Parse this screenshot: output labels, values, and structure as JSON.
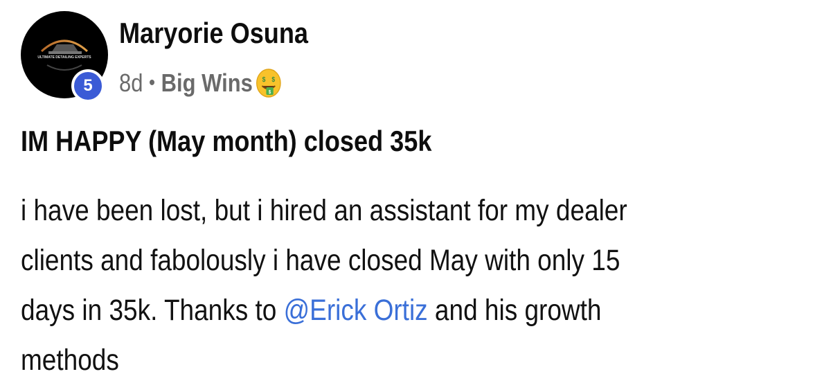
{
  "post": {
    "author_name": "Maryorie Osuna",
    "level": "5",
    "time_ago": "8d",
    "separator": "•",
    "category": "Big Wins",
    "category_emoji": "money-mouth-face-icon",
    "avatar_logo_text": "ULTIMATE DETAILING EXPERTS",
    "title": "IM HAPPY (May month) closed 35k",
    "body": {
      "line1": "i have been lost, but i hired an assistant for my dealer",
      "line2": "clients and fabolously i have closed May with only 15",
      "line3_before": "days in 35k. Thanks to ",
      "mention": "@Erick Ortiz",
      "line3_after": " and his growth",
      "line4": "methods"
    }
  },
  "colors": {
    "mention": "#3a6fd8",
    "level_badge": "#3b5bd6",
    "meta_text": "#6a6a6a"
  }
}
